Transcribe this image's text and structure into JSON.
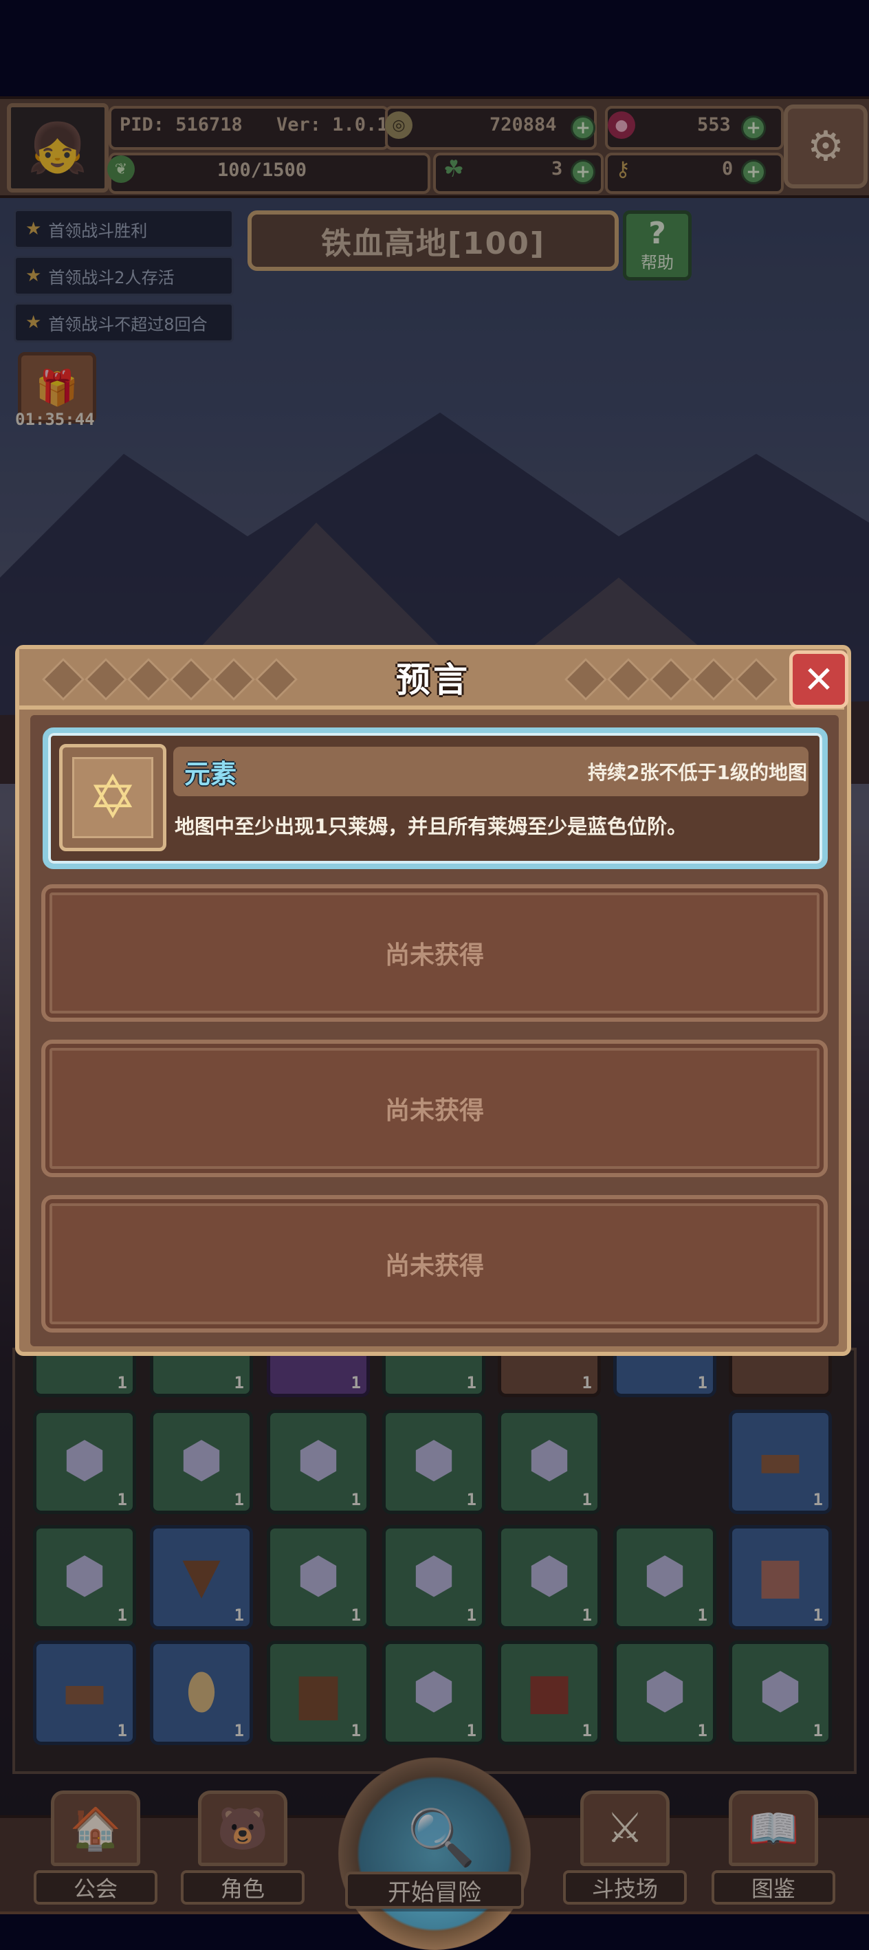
{
  "hud": {
    "pid": "PID: 516718",
    "version": "Ver: 1.0.1.2",
    "gold": "720884",
    "gems": "553",
    "stamina": "100/1500",
    "clover": "3",
    "key": "0"
  },
  "quests": [
    "首领战斗胜利",
    "首领战斗2人存活",
    "首领战斗不超过8回合"
  ],
  "stage": {
    "title": "铁血高地[100]",
    "help_label": "帮助"
  },
  "gift_timer": "01:35:44",
  "modal": {
    "title": "预言",
    "card": {
      "name": "元素",
      "duration": "持续2张不低于1级的地图",
      "description": "地图中至少出现1只莱姆，并且所有莱姆至少是蓝色位阶。"
    },
    "empty_slots": [
      "尚未获得",
      "尚未获得",
      "尚未获得"
    ]
  },
  "inventory_count": "1",
  "nav": {
    "guild": "公会",
    "character": "角色",
    "start": "开始冒险",
    "arena": "斗技场",
    "codex": "图鉴"
  },
  "colors": {
    "card_border": "#8fcde0",
    "card_name": "#8fdcf2",
    "close_button": "#c84242",
    "modal_frame": "#d4b183"
  }
}
